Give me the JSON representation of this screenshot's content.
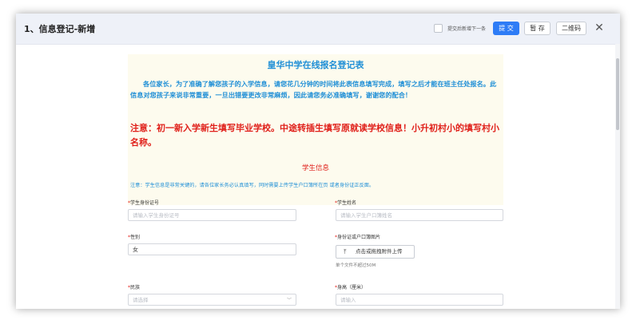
{
  "dialog": {
    "title": "1、信息登记-新增",
    "next_label": "提交后新增下一条",
    "submit_label": "提 交",
    "save_label": "暂 存",
    "qr_label": "二维码",
    "close_glyph": "✕"
  },
  "notice": {
    "title": "皇华中学在线报名登记表",
    "intro": "各位家长，为了准确了解您孩子的入学信息，请您花几分钟的时间将此表信息填写完成，填写之后才能在班主任处报名。此信息对您孩子来说非常重要，一旦出错要更改非常麻烦，因此请您务必准确填写，谢谢您的配合！",
    "warning": "注意：初一新入学新生填写毕业学校。中途转插生填写原就读学校信息！小升初村小的填写村小名称。"
  },
  "section": {
    "title": "学生信息",
    "note": "注意：学生信息是非常关键的，请各位家长务必认真填写，同时需要上传学生户口簿所在页 或者身份证正反面。"
  },
  "fields": {
    "id_card": {
      "required": "*",
      "label": "学生身份证号",
      "placeholder": "请输入学生身份证号"
    },
    "name": {
      "required": "*",
      "label": "学生姓名",
      "placeholder": "请输入学生户口簿姓名"
    },
    "gender": {
      "required": "*",
      "label": "性别",
      "value": "女"
    },
    "id_photo": {
      "required": "*",
      "label": "身份证或户口簿图片",
      "button": "点击或拖拽附件上传",
      "hint": "单个文件不超过50M",
      "icon": "upload-icon"
    },
    "ethnicity": {
      "required": "*",
      "label": "民族",
      "placeholder": "请选择"
    },
    "height": {
      "required": "*",
      "label": "身高（厘米）",
      "placeholder": "请输入"
    }
  },
  "colors": {
    "accent": "#2e7cf6",
    "notice_blue": "#1f8fd6",
    "warning_red": "#e0201a",
    "notice_bg": "#fdfbee"
  }
}
